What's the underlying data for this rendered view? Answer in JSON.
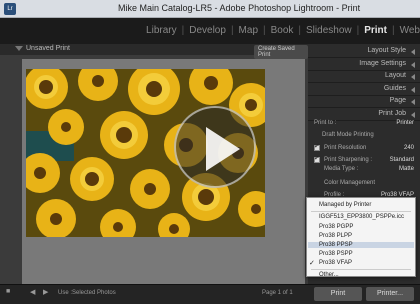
{
  "window": {
    "title": "Mike Main Catalog-LR5 - Adobe Photoshop Lightroom - Print"
  },
  "modules": [
    "Library",
    "Develop",
    "Map",
    "Book",
    "Slideshow",
    "Print",
    "Web"
  ],
  "active_module": "Print",
  "main": {
    "title": "Unsaved Print",
    "create_button": "Create Saved Print"
  },
  "right_panel": {
    "sections": [
      "Layout Style",
      "Image Settings",
      "Layout",
      "Guides",
      "Page",
      "Print Job"
    ],
    "print_to_label": "Print to :",
    "print_to_value": "Printer",
    "draft_mode": "Draft Mode Printing",
    "print_resolution_label": "Print Resolution",
    "print_resolution_value": "240",
    "print_sharpening_label": "Print Sharpening :",
    "print_sharpening_value": "Standard",
    "media_type_label": "Media Type :",
    "media_type_value": "Matte",
    "color_management": "Color Management",
    "profile_label": "Profile :",
    "profile_value": "Pro38 VFAP"
  },
  "dropdown": {
    "items": [
      "Managed by Printer",
      "IGGF513_EPP3800_PSPPe.icc",
      "Pro38 PGPP",
      "Pro38 PLPP",
      "Pro38 PPSP",
      "Pro38 PSPP",
      "Pro38 VFAP",
      "Other..."
    ],
    "highlighted": "Pro38 PPSP",
    "checked": "Pro38 VFAP"
  },
  "bottom": {
    "use_label": "Use :",
    "use_value": "Selected Photos",
    "page_label": "Page 1 of 1",
    "print_button": "Print",
    "printer_button": "Printer..."
  },
  "video": {
    "play_icon": "play-icon"
  }
}
